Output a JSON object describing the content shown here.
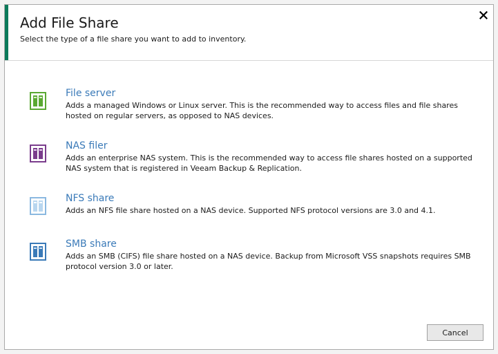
{
  "dialog": {
    "title": "Add File Share",
    "subtitle": "Select the type of a file share you want to add to inventory.",
    "close_icon": "close-icon"
  },
  "options": [
    {
      "title": "File server",
      "description": "Adds a managed Windows or Linux server. This is the recommended way to access files and file shares hosted on regular servers, as opposed to NAS devices.",
      "icon": "file-server-icon",
      "color": "#5aa832"
    },
    {
      "title": "NAS filer",
      "description": "Adds an enterprise NAS system. This is the recommended way to access file shares hosted on a supported NAS system that is registered in Veeam Backup & Replication.",
      "icon": "nas-filer-icon",
      "color": "#7a3c8c"
    },
    {
      "title": "NFS share",
      "description": "Adds an NFS file share hosted on a NAS device. Supported NFS protocol versions are 3.0 and 4.1.",
      "icon": "nfs-share-icon",
      "color": "#8ab8e0"
    },
    {
      "title": "SMB share",
      "description": "Adds an SMB (CIFS) file share hosted on a NAS device. Backup from Microsoft VSS snapshots requires SMB protocol version 3.0 or later.",
      "icon": "smb-share-icon",
      "color": "#3a7ab8"
    }
  ],
  "buttons": {
    "cancel": "Cancel"
  },
  "colors": {
    "accent": "#0b7a5a",
    "link": "#3a7ab8"
  }
}
